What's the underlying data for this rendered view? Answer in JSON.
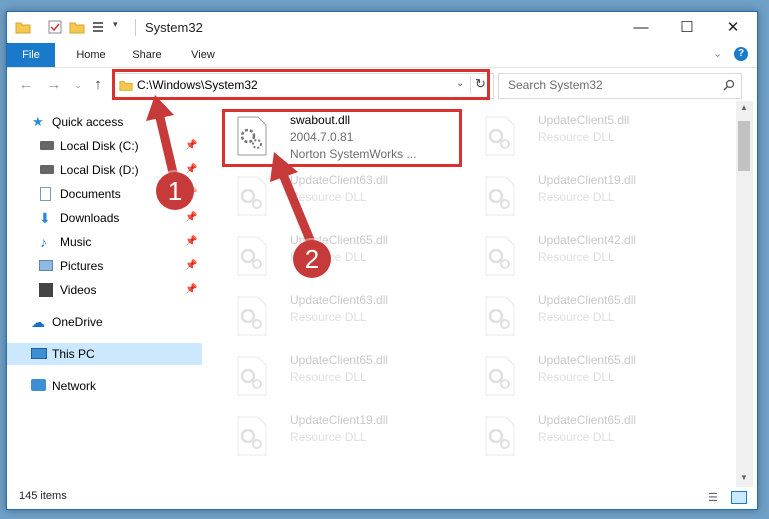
{
  "window": {
    "title": "System32",
    "tabs": [
      "File",
      "Home",
      "Share",
      "View"
    ]
  },
  "address": {
    "path": "C:\\Windows\\System32",
    "search_placeholder": "Search System32"
  },
  "nav": {
    "items": [
      {
        "label": "Quick access",
        "icon": "star-icon",
        "pinned": false
      },
      {
        "label": "Local Disk (C:)",
        "icon": "drive-icon",
        "pinned": true
      },
      {
        "label": "Local Disk (D:)",
        "icon": "drive-icon",
        "pinned": true
      },
      {
        "label": "Documents",
        "icon": "documents-icon",
        "pinned": true
      },
      {
        "label": "Downloads",
        "icon": "download-icon",
        "pinned": true
      },
      {
        "label": "Music",
        "icon": "music-icon",
        "pinned": true
      },
      {
        "label": "Pictures",
        "icon": "pictures-icon",
        "pinned": true
      },
      {
        "label": "Videos",
        "icon": "videos-icon",
        "pinned": true
      },
      {
        "label": "OneDrive",
        "icon": "cloud-icon",
        "pinned": false
      },
      {
        "label": "This PC",
        "icon": "computer-icon",
        "pinned": false,
        "selected": true
      },
      {
        "label": "Network",
        "icon": "network-icon",
        "pinned": false
      }
    ]
  },
  "files": [
    {
      "name": "swabout.dll",
      "line2": "2004.7.0.81",
      "line3": "Norton SystemWorks ...",
      "highlighted": true
    },
    {
      "name": "UpdateClient5.dll",
      "line2": "Resource DLL"
    },
    {
      "name": "UpdateClient63.dll",
      "line2": "Resource DLL"
    },
    {
      "name": "UpdateClient19.dll",
      "line2": "Resource DLL"
    },
    {
      "name": "UpdateClient65.dll",
      "line2": "Resource DLL"
    },
    {
      "name": "UpdateClient42.dll",
      "line2": "Resource DLL"
    },
    {
      "name": "UpdateClient63.dll",
      "line2": "Resource DLL"
    },
    {
      "name": "UpdateClient65.dll",
      "line2": "Resource DLL"
    },
    {
      "name": "UpdateClient65.dll",
      "line2": "Resource DLL"
    },
    {
      "name": "UpdateClient65.dll",
      "line2": "Resource DLL"
    },
    {
      "name": "UpdateClient19.dll",
      "line2": "Resource DLL"
    },
    {
      "name": "UpdateClient65.dll",
      "line2": "Resource DLL"
    }
  ],
  "status": {
    "item_count": "145 items"
  },
  "annotations": {
    "step1": "1",
    "step2": "2",
    "color": "#d9322e"
  }
}
